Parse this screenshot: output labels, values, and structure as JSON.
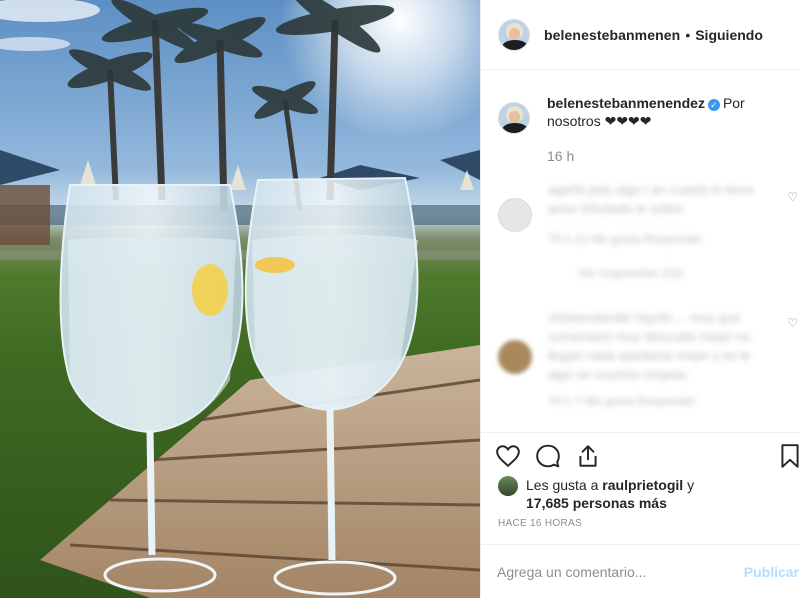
{
  "header": {
    "username": "belenestebanmenen",
    "separator": "•",
    "follow_status": "Siguiendo"
  },
  "caption": {
    "username": "belenestebanmenendez",
    "verified_icon": "verified-badge-icon",
    "text": "Por nosotros ❤❤❤❤",
    "time": "16 h"
  },
  "comments": [
    {
      "text": "agarfa pais algo t an cuanto lo tiene amor felicitado te sobre",
      "meta": "70 h   12 Me gusta   Responder",
      "replies": "Ver respuestas (10)"
    },
    {
      "text": "chiskandandie hayrils ... muy que comentario muy descuido mejor no llegan nada quedarse mejor y es le algo un muchos respeto",
      "meta": "70 h   7 Me gusta   Responder"
    }
  ],
  "likes": {
    "prefix": "Les gusta a ",
    "user": "raulprietogil",
    "suffix": " y",
    "count": "17,685 personas más"
  },
  "time_label": "HACE 16 HORAS",
  "comment_box": {
    "placeholder": "Agrega un comentario...",
    "publish_label": "Publicar"
  },
  "colors": {
    "accent": "#3897f0",
    "publish_disabled": "#b2dffc",
    "muted": "#8e8e8e"
  }
}
